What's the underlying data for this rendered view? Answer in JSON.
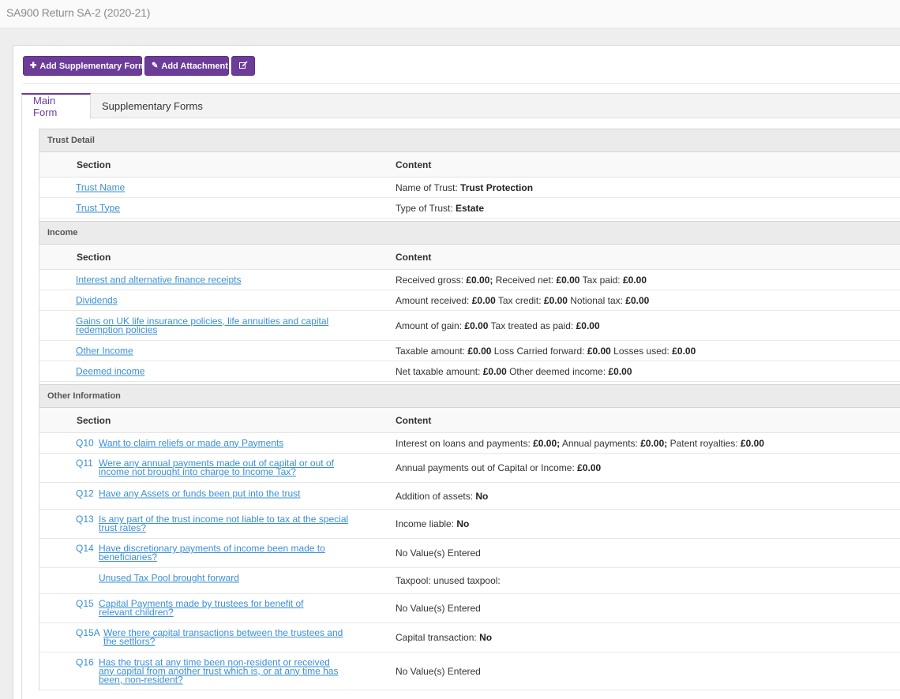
{
  "header": {
    "title": "SA900 Return SA-2 (2020-21)"
  },
  "toolbar": {
    "add_supplementary": "Add Supplementary Form",
    "add_attachment": "Add Attachment"
  },
  "tabs": {
    "main": "Main Form",
    "supplementary": "Supplementary Forms"
  },
  "columns": {
    "section": "Section",
    "content": "Content"
  },
  "sections": {
    "trust_detail": {
      "title": "Trust Detail",
      "rows": [
        {
          "link": "Trust Name",
          "content": [
            {
              "t": "Name of Trust: "
            },
            {
              "b": "Trust Protection"
            }
          ]
        },
        {
          "link": "Trust Type",
          "content": [
            {
              "t": "Type of Trust: "
            },
            {
              "b": "Estate"
            }
          ]
        }
      ]
    },
    "income": {
      "title": "Income",
      "rows": [
        {
          "link": "Interest and alternative finance receipts",
          "content": [
            {
              "t": "Received gross: "
            },
            {
              "b": "£0.00;"
            },
            {
              "t": " Received net: "
            },
            {
              "b": "£0.00"
            },
            {
              "t": " Tax paid: "
            },
            {
              "b": "£0.00"
            }
          ]
        },
        {
          "link": "Dividends",
          "content": [
            {
              "t": "Amount received: "
            },
            {
              "b": "£0.00"
            },
            {
              "t": " Tax credit: "
            },
            {
              "b": "£0.00"
            },
            {
              "t": " Notional tax: "
            },
            {
              "b": "£0.00"
            }
          ]
        },
        {
          "link": "Gains on UK life insurance policies, life annuities and capital redemption policies",
          "content": [
            {
              "t": "Amount of gain: "
            },
            {
              "b": "£0.00"
            },
            {
              "t": " Tax treated as paid: "
            },
            {
              "b": "£0.00"
            }
          ]
        },
        {
          "link": "Other Income",
          "content": [
            {
              "t": "Taxable amount: "
            },
            {
              "b": "£0.00"
            },
            {
              "t": " Loss Carried forward: "
            },
            {
              "b": "£0.00"
            },
            {
              "t": " Losses used: "
            },
            {
              "b": "£0.00"
            }
          ]
        },
        {
          "link": "Deemed income",
          "content": [
            {
              "t": "Net taxable amount: "
            },
            {
              "b": "£0.00"
            },
            {
              "t": " Other deemed income: "
            },
            {
              "b": "£0.00"
            }
          ]
        }
      ]
    },
    "other_information": {
      "title": "Other Information",
      "rows": [
        {
          "q": "Q10",
          "link": "Want to claim reliefs or made any Payments",
          "content": [
            {
              "t": "Interest on loans and payments: "
            },
            {
              "b": "£0.00;"
            },
            {
              "t": " Annual payments: "
            },
            {
              "b": "£0.00;"
            },
            {
              "t": " Patent royalties: "
            },
            {
              "b": "£0.00"
            }
          ]
        },
        {
          "q": "Q11",
          "link": "Were any annual payments made out of capital or out of income not brought into charge to Income Tax?",
          "content": [
            {
              "t": "Annual payments out of Capital or Income: "
            },
            {
              "b": "£0.00"
            }
          ]
        },
        {
          "q": "Q12",
          "link": "Have any Assets or funds been put into the trust",
          "content": [
            {
              "t": "Addition of assets: "
            },
            {
              "b": "No"
            }
          ]
        },
        {
          "q": "Q13",
          "link": "Is any part of the trust income not liable to tax at the special trust rates?",
          "content": [
            {
              "t": "Income liable: "
            },
            {
              "b": "No"
            }
          ]
        },
        {
          "q": "Q14",
          "link": "Have discretionary payments of income been made to beneficiaries?",
          "content": [
            {
              "t": "No Value(s) Entered"
            }
          ]
        },
        {
          "q": "",
          "link": "Unused Tax Pool brought forward",
          "content": [
            {
              "t": "Taxpool: unused taxpool:"
            }
          ]
        },
        {
          "q": "Q15",
          "link": "Capital Payments made by trustees for benefit of relevant children?",
          "content": [
            {
              "t": "No Value(s) Entered"
            }
          ]
        },
        {
          "q": "Q15A",
          "link": "Were there capital transactions between the trustees and the settlors?",
          "content": [
            {
              "t": "Capital transaction: "
            },
            {
              "b": "No"
            }
          ]
        },
        {
          "q": "Q16",
          "link": "Has the trust at any time been non-resident or received any capital from another trust which is, or at any time has been, non-resident?",
          "content": [
            {
              "t": "No Value(s) Entered"
            }
          ]
        }
      ]
    }
  },
  "colors": {
    "accent": "#6c3c98",
    "link": "#3a8fd6"
  },
  "icons": {
    "add": "plus-icon",
    "attach": "paperclip-icon",
    "edit": "edit-icon"
  }
}
